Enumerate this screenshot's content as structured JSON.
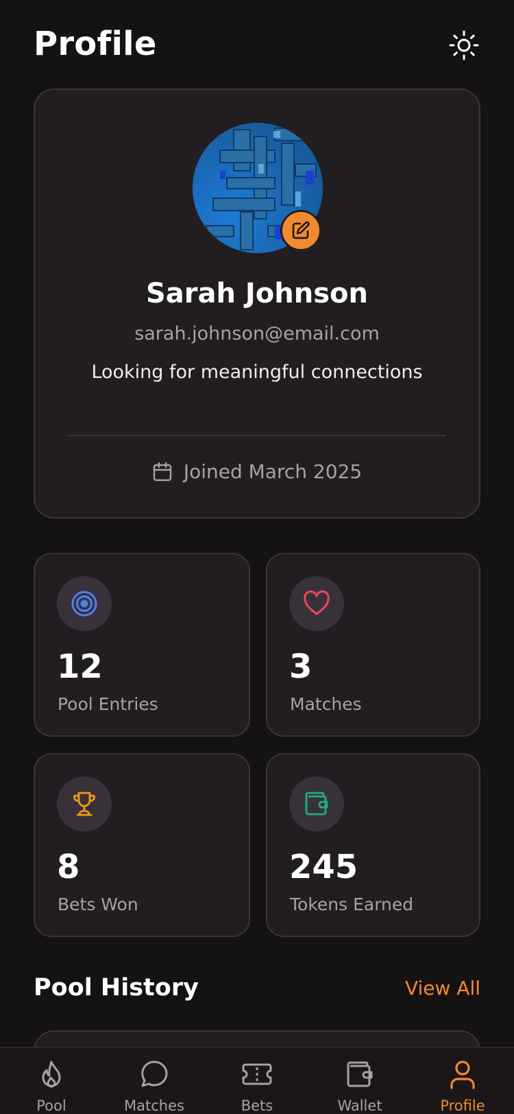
{
  "header": {
    "title": "Profile",
    "theme_icon": "sun-icon"
  },
  "profile": {
    "name": "Sarah Johnson",
    "email": "sarah.johnson@email.com",
    "bio": "Looking for meaningful connections",
    "joined": "Joined March 2025",
    "edit_icon": "edit-icon",
    "calendar_icon": "calendar-icon"
  },
  "stats": [
    {
      "value": "12",
      "label": "Pool Entries",
      "icon": "target-icon",
      "color": "#4a82f0"
    },
    {
      "value": "3",
      "label": "Matches",
      "icon": "heart-icon",
      "color": "#f0455e"
    },
    {
      "value": "8",
      "label": "Bets Won",
      "icon": "trophy-icon",
      "color": "#f09a1a"
    },
    {
      "value": "245",
      "label": "Tokens Earned",
      "icon": "wallet-icon",
      "color": "#22b07a"
    }
  ],
  "pool_history": {
    "title": "Pool History",
    "view_all": "View All"
  },
  "nav": [
    {
      "label": "Pool",
      "icon": "flame-icon",
      "active": false
    },
    {
      "label": "Matches",
      "icon": "chat-bubble-icon",
      "active": false
    },
    {
      "label": "Bets",
      "icon": "ticket-icon",
      "active": false
    },
    {
      "label": "Wallet",
      "icon": "wallet-icon",
      "active": false
    },
    {
      "label": "Profile",
      "icon": "user-icon",
      "active": true
    }
  ],
  "colors": {
    "accent": "#f48a2f",
    "background": "#151214",
    "card": "#221d21"
  }
}
